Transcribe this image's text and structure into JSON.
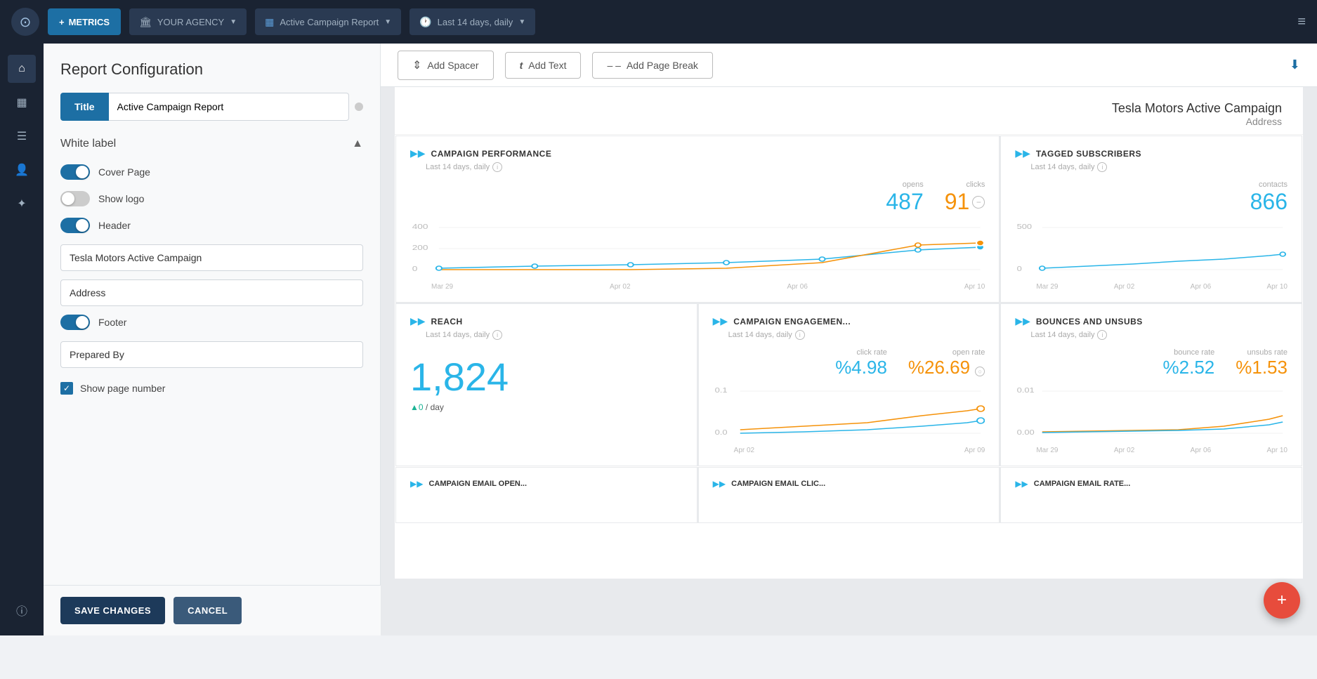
{
  "topNav": {
    "logoText": "⊙",
    "metricsLabel": "METRICS",
    "addIcon": "+",
    "agencyLabel": "YOUR AGENCY",
    "reportLabel": "Active Campaign Report",
    "dateRangeLabel": "Last 14 days, daily",
    "menuIcon": "≡"
  },
  "leftSidebar": {
    "icons": [
      {
        "name": "home-icon",
        "glyph": "⌂"
      },
      {
        "name": "dashboard-icon",
        "glyph": "▦"
      },
      {
        "name": "reports-icon",
        "glyph": "☰"
      },
      {
        "name": "contacts-icon",
        "glyph": "👤"
      },
      {
        "name": "campaigns-icon",
        "glyph": "✦"
      },
      {
        "name": "info-icon",
        "glyph": "ⓘ"
      }
    ]
  },
  "configPanel": {
    "title": "Report Configuration",
    "titleLabel": "Title",
    "titleValue": "Active Campaign Report",
    "titleDot": true,
    "whiteLabel": {
      "sectionLabel": "White label",
      "coverPage": {
        "label": "Cover Page",
        "on": true
      },
      "showLogo": {
        "label": "Show logo",
        "on": false
      },
      "header": {
        "label": "Header",
        "on": true
      },
      "headerText": "Tesla Motors Active Campaign",
      "addressText": "Address",
      "footer": {
        "label": "Footer",
        "on": true
      },
      "preparedByText": "Prepared By",
      "showPageNumber": {
        "label": "Show page number",
        "checked": true
      }
    },
    "saveLabel": "SAVE CHANGES",
    "cancelLabel": "CANCEL"
  },
  "toolbar": {
    "addSpacerLabel": "Add Spacer",
    "addTextLabel": "Add Text",
    "addPageBreakLabel": "Add Page Break",
    "downloadIcon": "⬇"
  },
  "report": {
    "headerTitle": "Tesla Motors Active Campaign",
    "headerAddress": "Address",
    "widgets": [
      {
        "id": "campaign-performance",
        "title": "CAMPAIGN PERFORMANCE",
        "subtitle": "Last 14 days, daily",
        "wide": true,
        "metrics": [
          {
            "label": "opens",
            "value": "487",
            "color": "blue"
          },
          {
            "label": "clicks",
            "value": "91",
            "color": "orange"
          }
        ],
        "chartDates": [
          "Mar 29",
          "Apr 02",
          "Apr 06",
          "Apr 10"
        ],
        "chartYLabels": [
          "400",
          "200",
          "0"
        ]
      },
      {
        "id": "tagged-subscribers",
        "title": "TAGGED SUBSCRIBERS",
        "subtitle": "Last 14 days, daily",
        "wide": false,
        "metrics": [
          {
            "label": "contacts",
            "value": "866",
            "color": "blue"
          }
        ],
        "chartDates": [
          "Mar 29",
          "Apr 02",
          "Apr 06",
          "Apr 10"
        ],
        "chartYLabels": [
          "500",
          "0"
        ]
      },
      {
        "id": "reach",
        "title": "REACH",
        "subtitle": "Last 14 days, daily",
        "wide": false,
        "reachValue": "1,824",
        "reachDelta": "▲0 / day"
      },
      {
        "id": "campaign-engagement",
        "title": "CAMPAIGN ENGAGEMEN...",
        "subtitle": "Last 14 days, daily",
        "wide": false,
        "metrics": [
          {
            "label": "click rate",
            "value": "%4.98",
            "color": "blue"
          },
          {
            "label": "open rate",
            "value": "%26.69",
            "color": "orange"
          }
        ],
        "chartDates": [
          "Apr 02",
          "Apr 09"
        ],
        "chartYLabels": [
          "0.1",
          "0.0"
        ]
      },
      {
        "id": "bounces-unsubs",
        "title": "BOUNCES AND UNSUBS",
        "subtitle": "Last 14 days, daily",
        "wide": false,
        "metrics": [
          {
            "label": "bounce rate",
            "value": "%2.52",
            "color": "blue"
          },
          {
            "label": "unsubs rate",
            "value": "%1.53",
            "color": "orange"
          }
        ],
        "chartDates": [
          "Mar 29",
          "Apr 02",
          "Apr 06",
          "Apr 10"
        ],
        "chartYLabels": [
          "0.01",
          "0.00"
        ]
      }
    ],
    "bottomWidgetLabels": [
      "CAMPAIGN EMAIL OPEN...",
      "CAMPAIGN EMAIL CLIC...",
      "CAMPAIGN EMAIL RATE..."
    ]
  },
  "fab": {
    "icon": "+"
  }
}
